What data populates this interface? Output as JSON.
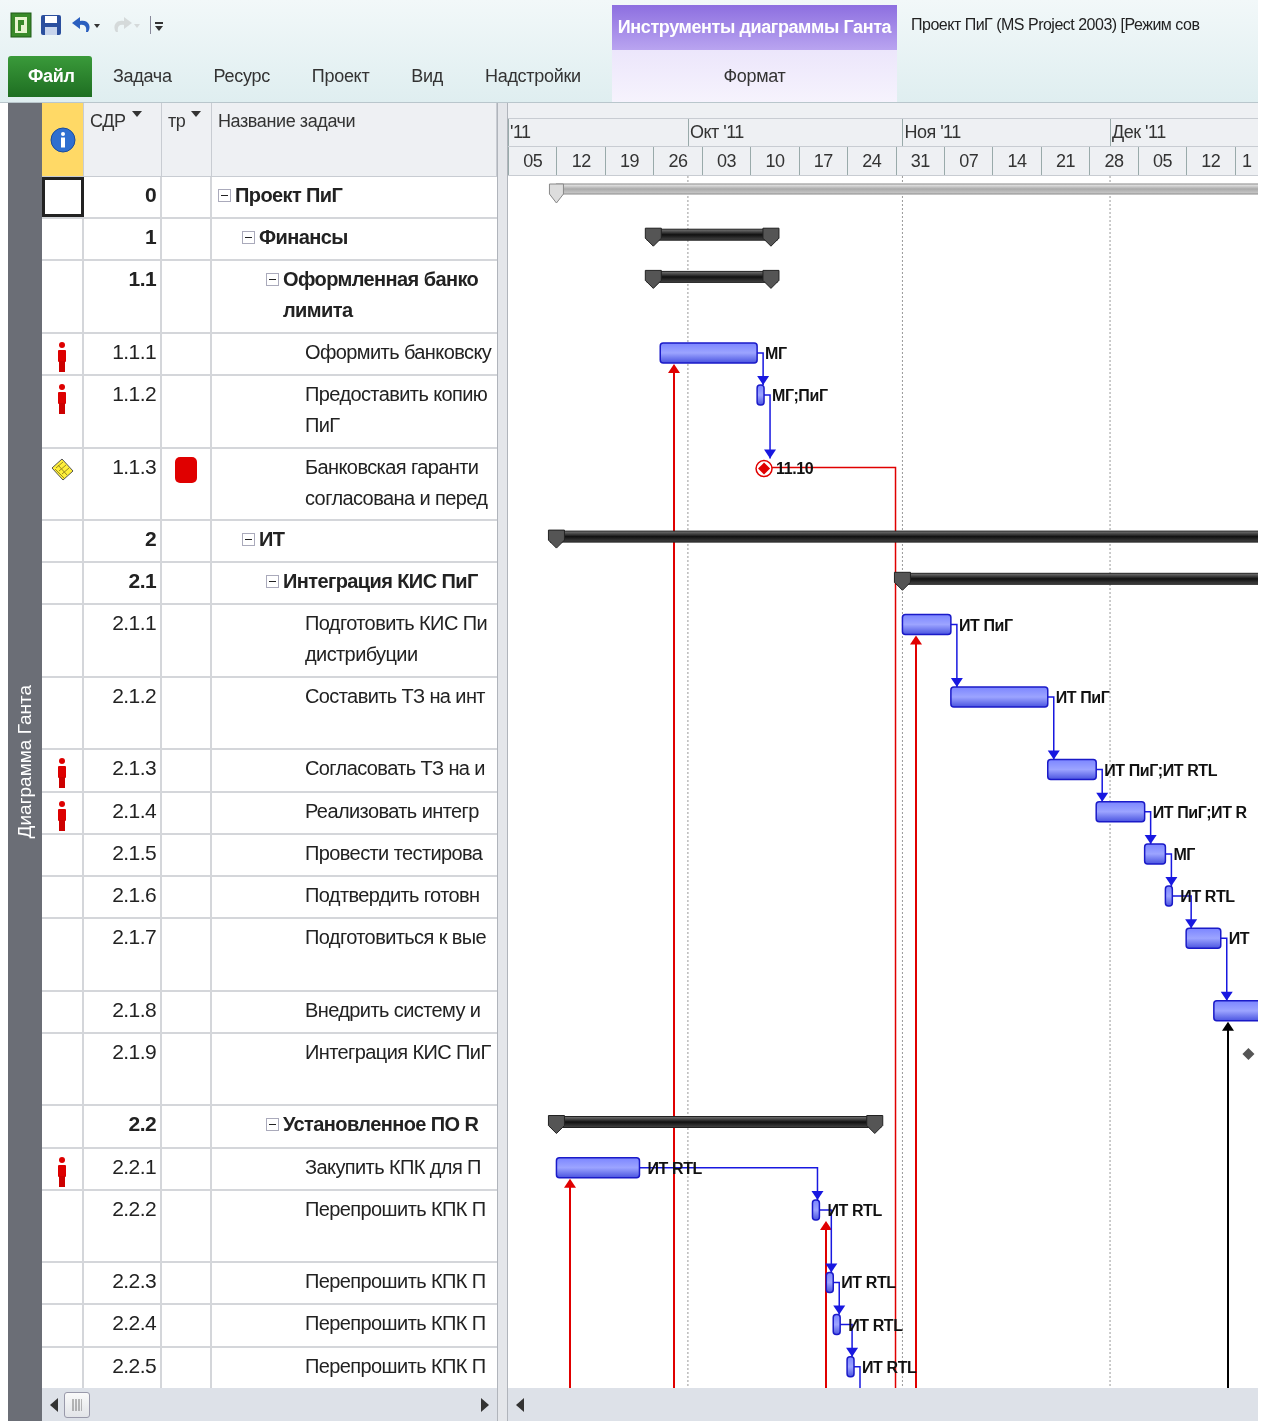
{
  "window": {
    "title": "Проект ПиГ (MS Project 2003) [Режим сов"
  },
  "quick_access": [
    {
      "kind": "logo",
      "disabled": false
    },
    {
      "kind": "save",
      "disabled": false
    },
    {
      "kind": "undo",
      "disabled": false
    },
    {
      "kind": "redo",
      "disabled": true
    },
    {
      "kind": "customize",
      "disabled": false
    }
  ],
  "ribbon": {
    "tabs": [
      {
        "label": "Файл",
        "kind": "file"
      },
      {
        "label": "Задача",
        "kind": "tab"
      },
      {
        "label": "Ресурс",
        "kind": "tab"
      },
      {
        "label": "Проект",
        "kind": "tab"
      },
      {
        "label": "Вид",
        "kind": "tab"
      },
      {
        "label": "Надстройки",
        "kind": "tab"
      }
    ],
    "context": {
      "title": "Инструменты диаграммы Ганта",
      "tabs": [
        {
          "label": "Формат"
        }
      ]
    }
  },
  "view_bar": {
    "label": "Диаграмма Ганта"
  },
  "table": {
    "columns": [
      {
        "kind": "info"
      },
      {
        "label": "СДР",
        "kind": "menu"
      },
      {
        "label": "тр",
        "kind": "menu"
      },
      {
        "label": "Название задачи",
        "kind": "plain"
      }
    ],
    "tasks": [
      {
        "wbs": "0",
        "lines": [
          "Проект ПиГ"
        ],
        "selected": true,
        "expanded": true,
        "bar": {
          "kind": "project"
        },
        "children": [
          {
            "wbs": "1",
            "lines": [
              "Финансы"
            ],
            "selected": false,
            "expanded": true,
            "bar": {
              "kind": "summary"
            },
            "children": [
              {
                "wbs": "1.1",
                "lines": [
                  "Оформленная банко",
                  "лимита"
                ],
                "selected": false,
                "expanded": true,
                "bar": {
                  "kind": "summary"
                },
                "children": [
                  {
                    "wbs": "1.1.1",
                    "lines": [
                      "Оформить банковску"
                    ],
                    "selected": false,
                    "indicator": {
                      "kind": "person"
                    },
                    "bar": {
                      "kind": "task",
                      "label": "МГ",
                      "link_to_next": true,
                      "link_from_below": {
                        "color": "#e00000"
                      }
                    }
                  },
                  {
                    "wbs": "1.1.2",
                    "lines": [
                      "Предоставить копию",
                      "ПиГ"
                    ],
                    "selected": false,
                    "indicator": {
                      "kind": "person"
                    },
                    "bar": {
                      "kind": "task",
                      "label": "МГ;ПиГ",
                      "link_to_next": true
                    }
                  },
                  {
                    "wbs": "1.1.3",
                    "lines": [
                      "Банковская гаранти",
                      "согласована и перед"
                    ],
                    "selected": false,
                    "indicator": {
                      "kind": "note"
                    },
                    "flag": {
                      "color": "#e00000"
                    },
                    "bar": {
                      "kind": "milestone",
                      "color": "#e00000",
                      "label": "11.10",
                      "link_to_below": {
                        "color": "#e00000"
                      }
                    }
                  }
                ]
              }
            ]
          },
          {
            "wbs": "2",
            "lines": [
              "ИТ"
            ],
            "selected": false,
            "expanded": true,
            "bar": {
              "kind": "summary"
            },
            "children": [
              {
                "wbs": "2.1",
                "lines": [
                  "Интеграция КИС ПиГ"
                ],
                "selected": false,
                "expanded": true,
                "bar": {
                  "kind": "summary"
                },
                "children": [
                  {
                    "wbs": "2.1.1",
                    "lines": [
                      "Подготовить КИС Пи",
                      "дистрибуции"
                    ],
                    "selected": false,
                    "bar": {
                      "kind": "task",
                      "label": "ИТ ПиГ",
                      "link_to_next": true,
                      "link_from_below": {
                        "color": "#e00000"
                      }
                    }
                  },
                  {
                    "wbs": "2.1.2",
                    "lines": [
                      "Составить ТЗ на инт"
                    ],
                    "tall": true,
                    "selected": false,
                    "bar": {
                      "kind": "task",
                      "label": "ИТ ПиГ",
                      "link_to_next": true
                    }
                  },
                  {
                    "wbs": "2.1.3",
                    "lines": [
                      "Согласовать ТЗ на и"
                    ],
                    "selected": false,
                    "indicator": {
                      "kind": "person"
                    },
                    "bar": {
                      "kind": "task",
                      "label": "ИТ ПиГ;ИТ RTL",
                      "link_to_next": true
                    }
                  },
                  {
                    "wbs": "2.1.4",
                    "lines": [
                      "Реализовать интегр"
                    ],
                    "selected": false,
                    "indicator": {
                      "kind": "person"
                    },
                    "bar": {
                      "kind": "task",
                      "label": "ИТ ПиГ;ИТ R",
                      "link_to_next": true
                    }
                  },
                  {
                    "wbs": "2.1.5",
                    "lines": [
                      "Провести тестирова"
                    ],
                    "selected": false,
                    "bar": {
                      "kind": "task",
                      "label": "МГ",
                      "link_to_next": true
                    }
                  },
                  {
                    "wbs": "2.1.6",
                    "lines": [
                      "Подтвердить готовн"
                    ],
                    "selected": false,
                    "bar": {
                      "kind": "task",
                      "label": "ИТ RTL",
                      "link_to_next": true
                    }
                  },
                  {
                    "wbs": "2.1.7",
                    "lines": [
                      "Подготовиться к вые"
                    ],
                    "tall": true,
                    "selected": false,
                    "bar": {
                      "kind": "task",
                      "label": "ИТ",
                      "link_to_next": true
                    }
                  },
                  {
                    "wbs": "2.1.8",
                    "lines": [
                      "Внедрить систему и"
                    ],
                    "selected": false,
                    "bar": {
                      "kind": "task",
                      "link_from_below": {
                        "color": "#000000"
                      }
                    }
                  },
                  {
                    "wbs": "2.1.9",
                    "lines": [
                      "Интеграция КИС ПиГ"
                    ],
                    "tall": true,
                    "selected": false,
                    "bar": {
                      "kind": "milestone",
                      "color": "#555555"
                    }
                  }
                ]
              },
              {
                "wbs": "2.2",
                "lines": [
                  "Установленное ПО R"
                ],
                "selected": false,
                "expanded": true,
                "bar": {
                  "kind": "summary"
                },
                "children": [
                  {
                    "wbs": "2.2.1",
                    "lines": [
                      "Закупить КПК для П"
                    ],
                    "selected": false,
                    "indicator": {
                      "kind": "person"
                    },
                    "bar": {
                      "kind": "task",
                      "label": "ИТ RTL",
                      "link_to_next": true,
                      "link_from_below": {
                        "color": "#e00000"
                      }
                    }
                  },
                  {
                    "wbs": "2.2.2",
                    "lines": [
                      "Перепрошить КПК П"
                    ],
                    "tall": true,
                    "selected": false,
                    "bar": {
                      "kind": "task",
                      "label": "ИТ RTL",
                      "link_to_next": true,
                      "link_from_below": {
                        "color": "#e00000"
                      }
                    }
                  },
                  {
                    "wbs": "2.2.3",
                    "lines": [
                      "Перепрошить КПК П"
                    ],
                    "selected": false,
                    "bar": {
                      "kind": "task",
                      "label": "ИТ RTL",
                      "link_to_next": true
                    }
                  },
                  {
                    "wbs": "2.2.4",
                    "lines": [
                      "Перепрошить КПК П"
                    ],
                    "selected": false,
                    "bar": {
                      "kind": "task",
                      "label": "ИТ RTL",
                      "link_to_next": true
                    }
                  },
                  {
                    "wbs": "2.2.5",
                    "lines": [
                      "Перепрошить КПК П"
                    ],
                    "selected": false,
                    "bar": {
                      "kind": "task",
                      "label": "ИТ RTL",
                      "link_to_next": true
                    }
                  }
                ]
              }
            ]
          }
        ]
      }
    ]
  },
  "timescale": {
    "months": [
      {
        "label": "'11"
      },
      {
        "label": "Окт '11"
      },
      {
        "label": "Ноя '11"
      },
      {
        "label": "Дек '11"
      }
    ],
    "weeks": [
      {
        "label": "05"
      },
      {
        "label": "12"
      },
      {
        "label": "19"
      },
      {
        "label": "26"
      },
      {
        "label": "03"
      },
      {
        "label": "10"
      },
      {
        "label": "17"
      },
      {
        "label": "24"
      },
      {
        "label": "31"
      },
      {
        "label": "07"
      },
      {
        "label": "14"
      },
      {
        "label": "21"
      },
      {
        "label": "28"
      },
      {
        "label": "05"
      },
      {
        "label": "12"
      },
      {
        "label": "1"
      }
    ]
  }
}
